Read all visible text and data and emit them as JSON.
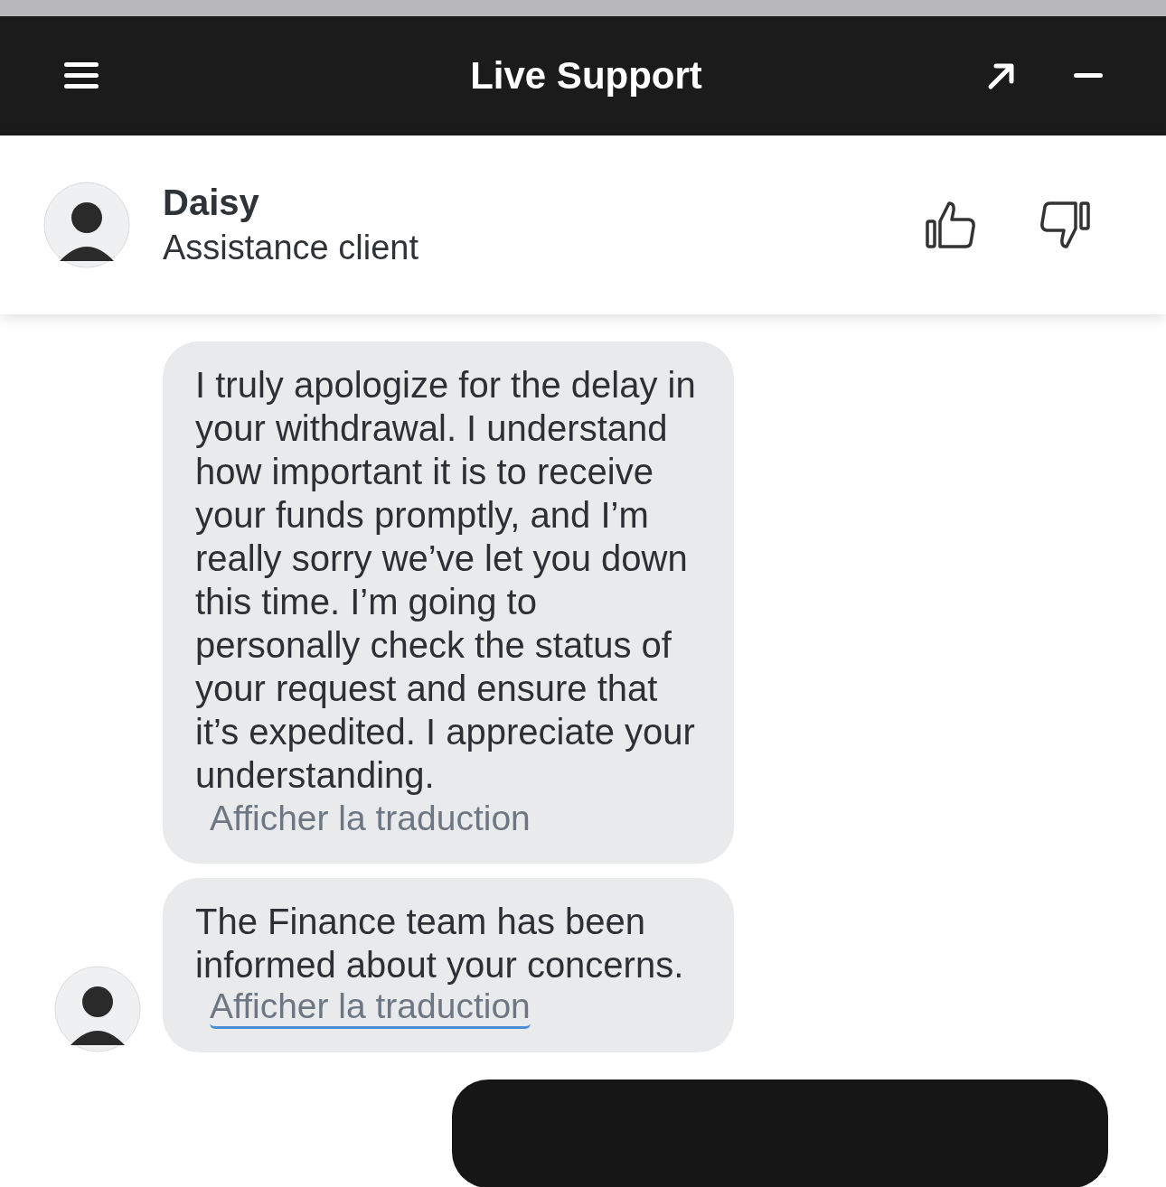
{
  "window": {
    "title": "Live Support"
  },
  "agent": {
    "name": "Daisy",
    "role": "Assistance client"
  },
  "messages": [
    {
      "kind": "incoming",
      "text": "I truly apologize for the delay in your withdrawal. I understand how important it is to receive your funds promptly, and I’m really sorry we’ve let you down this time. I’m going to personally check the status of your request and ensure that it’s expedited. I appreciate your understanding.",
      "link": "Afficher la traduction",
      "focused": false,
      "avatar": false
    },
    {
      "kind": "incoming",
      "text": "The Finance team has been informed about your concerns.",
      "link": "Afficher la traduction",
      "focused": true,
      "avatar": true
    },
    {
      "kind": "outgoing"
    }
  ]
}
